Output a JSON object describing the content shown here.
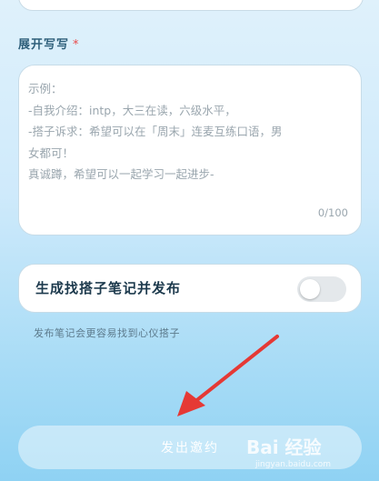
{
  "section": {
    "title": "展开写写",
    "required_mark": "*"
  },
  "textarea": {
    "placeholder_lines": [
      "示例：",
      "-自我介绍：intp，大三在读，六级水平，",
      "-搭子诉求：希望可以在「周末」连麦互练口语，男",
      "女都可！",
      "真诚蹲，希望可以一起学习一起进步-"
    ],
    "counter": "0/100"
  },
  "toggle_card": {
    "label": "生成找搭子笔记并发布",
    "enabled": false
  },
  "hint": "发布笔记会更容易找到心仪搭子",
  "submit_button": {
    "label": "发出邀约"
  },
  "watermark": {
    "text": "Bai 经验",
    "sub": "jingyan.baidu.com"
  },
  "colors": {
    "required": "#ea4b4b",
    "arrow": "#e53935"
  }
}
